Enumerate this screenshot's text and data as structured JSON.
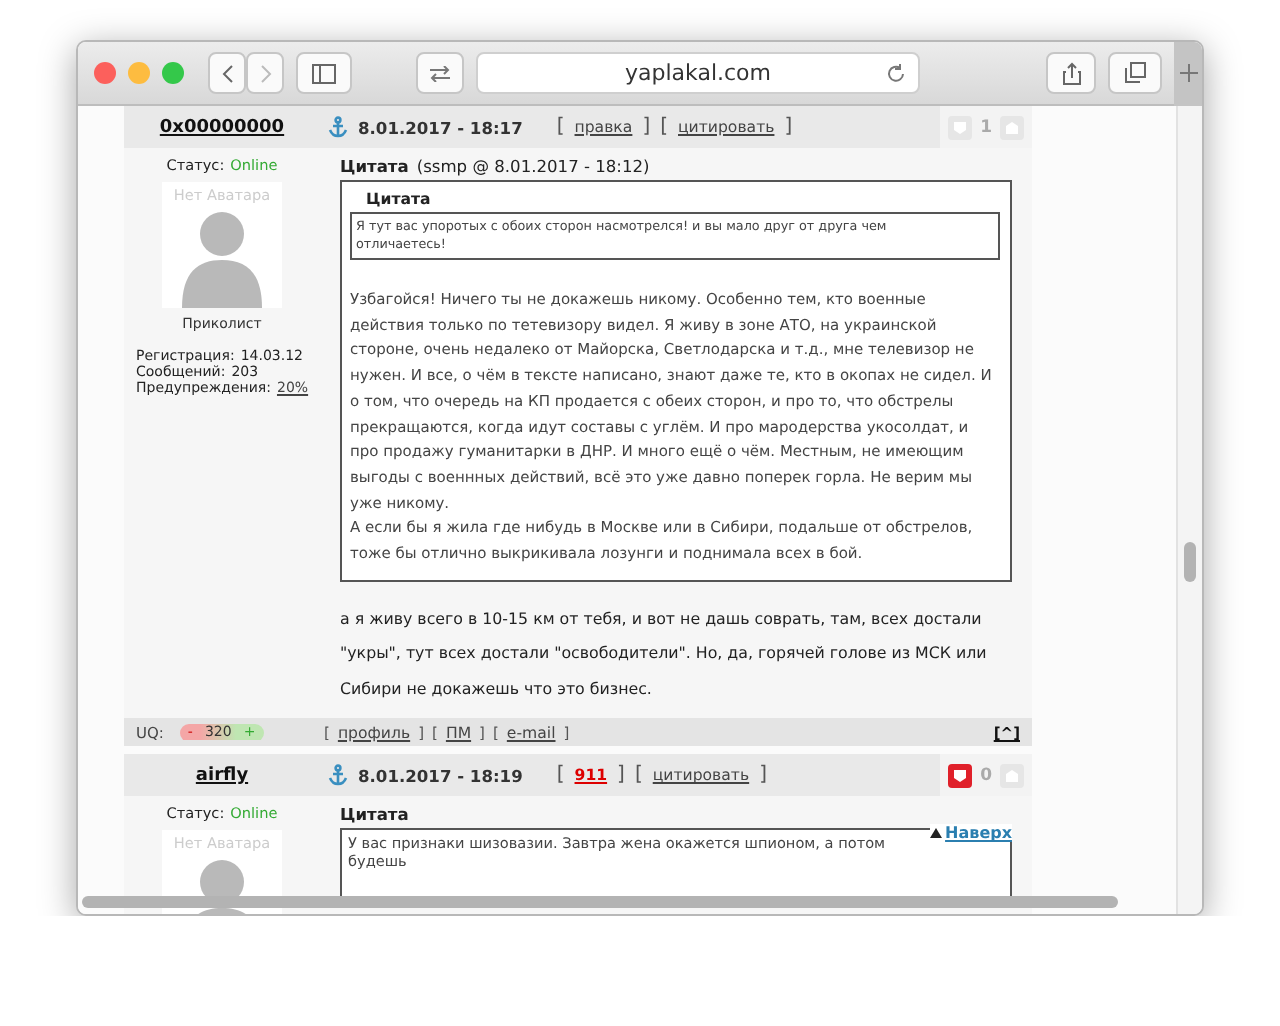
{
  "browser": {
    "url": "yaplakal.com"
  },
  "posts": [
    {
      "author": "0x00000000",
      "date": "8.01.2017 - 18:17",
      "links": [
        {
          "label": "правка",
          "kind": "link"
        },
        {
          "label": "цитировать",
          "kind": "link"
        }
      ],
      "bracket_open": "[",
      "bracket_close": "]",
      "votes": "1",
      "voted": false,
      "status_label": "Статус:",
      "status": "Online",
      "avatar_text": "Нет Аватара",
      "rank": "Приколист",
      "stats": [
        {
          "label": "Регистрация:",
          "value": "14.03.12",
          "link": false
        },
        {
          "label": "Сообщений:",
          "value": "203",
          "link": false
        },
        {
          "label": "Предупреждения:",
          "value": "20%",
          "link": true
        }
      ],
      "quote": {
        "title": "Цитата",
        "source": "(ssmp @ 8.01.2017 - 18:12)",
        "nested_title": "Цитата",
        "nested_text": "Я тут вас упоротых с обоих сторон насмотрелся! и вы мало друг от друга чем отличаетесь!",
        "paragraphs": [
          "Узбагойся! Ничего ты не докажешь никому. Особенно тем, кто военные действия только по тетевизору видел. Я живу в зоне АТО, на украинской стороне, очень недалеко от Майорска, Светлодарска и т.д., мне телевизор не нужен. И все, о чём в тексте написано, знают даже те, кто в окопах не сидел. И о том, что очередь на КП продается с обеих сторон, и про то, что обстрелы прекращаются, когда идут составы с углём. И про мародерства укосолдат, и про продажу гуманитарки в ДНР. И много ещё о чём. Местным, не имеющим выгоды с военнных действий, всё это уже давно поперек горла. Не верим мы уже никому.",
          "А если бы я жила где нибудь в Москве или в Сибири, подальше от обстрелов, тоже бы отлично выкрикивала лозунги и поднимала всех в бой."
        ]
      },
      "reply": "а я живу всего в 10-15 км от тебя, и вот не дашь соврать, там, всех достали \"укры\", тут всех достали \"освободители\". Но, да, горячей голове из МСК или Сибири не докажешь что это бизнес.",
      "footer": {
        "uq_label": "UQ:",
        "rating": {
          "minus": "-",
          "value": "320",
          "plus": "+"
        },
        "links": [
          "профиль",
          "ПМ",
          "e-mail"
        ],
        "top": "[^]"
      }
    },
    {
      "author": "airfly",
      "date": "8.01.2017 - 18:19",
      "links": [
        {
          "label": "911",
          "kind": "alert"
        },
        {
          "label": "цитировать",
          "kind": "link"
        }
      ],
      "bracket_open": "[",
      "bracket_close": "]",
      "votes": "0",
      "voted": true,
      "status_label": "Статус:",
      "status": "Online",
      "avatar_text": "Нет Аватара",
      "quote": {
        "title": "Цитата",
        "text": "У вас признаки шизовазии. Завтра жена окажется шпионом, а потом будешь"
      }
    }
  ],
  "back_to_top": "Наверх"
}
